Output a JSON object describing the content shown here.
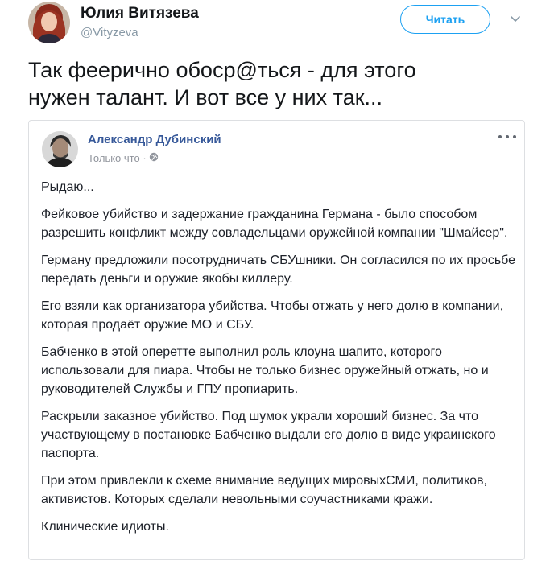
{
  "tweet": {
    "author_name": "Юлия Витязева",
    "author_handle": "@Vityzeva",
    "follow_label": "Читать",
    "text": "Так феерично обоср@ться - для этого\nнужен талант. И вот все у них так..."
  },
  "fb_post": {
    "author_name": "Александр Дубинский",
    "timestamp": "Только что ·",
    "paragraphs": [
      "Рыдаю...",
      "Фейковое убийство и задержание гражданина Германа - было способом разрешить конфликт между совладельцами оружейной компании \"Шмайсер\".",
      "Герману предложили посотрудничать СБУшники. Он согласился по их просьбе передать деньги и оружие якобы киллеру.",
      "Его взяли как организатора убийства. Чтобы отжать у него долю в компании, которая продаёт оружие МО и СБУ.",
      "Бабченко в этой оперетте выполнил роль клоуна шапито, которого использовали для пиара. Чтобы не только бизнес оружейный отжать, но и руководителей Службы и ГПУ пропиарить.",
      "Раскрыли заказное убийство. Под шумок украли хороший бизнес. За что участвующему в постановке Бабченко выдали его долю в виде украинского паспорта.",
      "При этом привлекли к схеме внимание ведущих мировыхСМИ, политиков, активистов. Которых сделали невольными соучастниками кражи.",
      "Клинические идиоты."
    ]
  },
  "colors": {
    "twitter_blue": "#1da1f2",
    "fb_link_blue": "#365899",
    "muted_gray": "#8899a6"
  },
  "icons": {
    "follow_menu": "chevron-down-icon",
    "privacy": "globe-icon",
    "post_menu": "more-dots-icon"
  }
}
